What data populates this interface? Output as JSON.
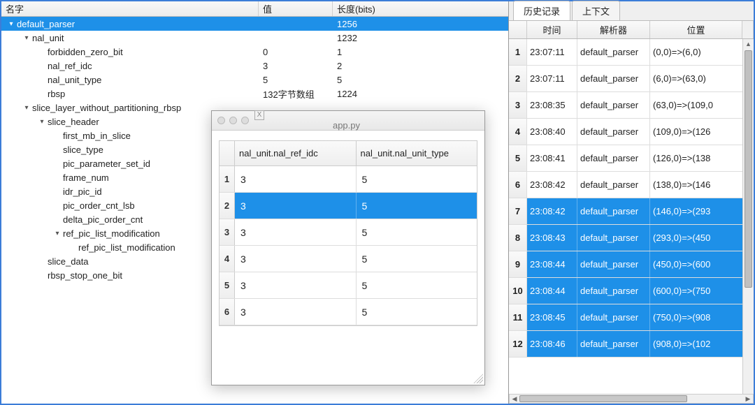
{
  "left": {
    "headers": {
      "name": "名字",
      "value": "值",
      "length": "长度(bits)"
    },
    "rows": [
      {
        "indent": 0,
        "toggle": "▾",
        "name": "default_parser",
        "value": "",
        "length": "1256",
        "selected": true
      },
      {
        "indent": 1,
        "toggle": "▾",
        "name": "nal_unit",
        "value": "",
        "length": "1232"
      },
      {
        "indent": 2,
        "toggle": "",
        "name": "forbidden_zero_bit",
        "value": "0",
        "length": "1"
      },
      {
        "indent": 2,
        "toggle": "",
        "name": "nal_ref_idc",
        "value": "3",
        "length": "2"
      },
      {
        "indent": 2,
        "toggle": "",
        "name": "nal_unit_type",
        "value": "5",
        "length": "5"
      },
      {
        "indent": 2,
        "toggle": "",
        "name": "rbsp",
        "value": "132字节数组",
        "length": "1224"
      },
      {
        "indent": 1,
        "toggle": "▾",
        "name": "slice_layer_without_partitioning_rbsp",
        "value": "",
        "length": ""
      },
      {
        "indent": 2,
        "toggle": "▾",
        "name": "slice_header",
        "value": "",
        "length": ""
      },
      {
        "indent": 3,
        "toggle": "",
        "name": "first_mb_in_slice",
        "value": "",
        "length": ""
      },
      {
        "indent": 3,
        "toggle": "",
        "name": "slice_type",
        "value": "",
        "length": ""
      },
      {
        "indent": 3,
        "toggle": "",
        "name": "pic_parameter_set_id",
        "value": "",
        "length": ""
      },
      {
        "indent": 3,
        "toggle": "",
        "name": "frame_num",
        "value": "",
        "length": ""
      },
      {
        "indent": 3,
        "toggle": "",
        "name": "idr_pic_id",
        "value": "",
        "length": ""
      },
      {
        "indent": 3,
        "toggle": "",
        "name": "pic_order_cnt_lsb",
        "value": "",
        "length": ""
      },
      {
        "indent": 3,
        "toggle": "",
        "name": "delta_pic_order_cnt",
        "value": "",
        "length": ""
      },
      {
        "indent": 3,
        "toggle": "▾",
        "name": "ref_pic_list_modification",
        "value": "",
        "length": ""
      },
      {
        "indent": 4,
        "toggle": "",
        "name": "ref_pic_list_modification",
        "value": "",
        "length": ""
      },
      {
        "indent": 2,
        "toggle": "",
        "name": "slice_data",
        "value": "",
        "length": ""
      },
      {
        "indent": 2,
        "toggle": "",
        "name": "rbsp_stop_one_bit",
        "value": "",
        "length": ""
      }
    ]
  },
  "tabs": {
    "history": "历史记录",
    "context": "上下文"
  },
  "history": {
    "headers": {
      "time": "时间",
      "parser": "解析器",
      "position": "位置"
    },
    "rows": [
      {
        "idx": "1",
        "time": "23:07:11",
        "parser": "default_parser",
        "pos": "(0,0)=>(6,0)",
        "selected": false
      },
      {
        "idx": "2",
        "time": "23:07:11",
        "parser": "default_parser",
        "pos": "(6,0)=>(63,0)",
        "selected": false
      },
      {
        "idx": "3",
        "time": "23:08:35",
        "parser": "default_parser",
        "pos": "(63,0)=>(109,0",
        "selected": false
      },
      {
        "idx": "4",
        "time": "23:08:40",
        "parser": "default_parser",
        "pos": "(109,0)=>(126",
        "selected": false
      },
      {
        "idx": "5",
        "time": "23:08:41",
        "parser": "default_parser",
        "pos": "(126,0)=>(138",
        "selected": false
      },
      {
        "idx": "6",
        "time": "23:08:42",
        "parser": "default_parser",
        "pos": "(138,0)=>(146",
        "selected": false
      },
      {
        "idx": "7",
        "time": "23:08:42",
        "parser": "default_parser",
        "pos": "(146,0)=>(293",
        "selected": true
      },
      {
        "idx": "8",
        "time": "23:08:43",
        "parser": "default_parser",
        "pos": "(293,0)=>(450",
        "selected": true
      },
      {
        "idx": "9",
        "time": "23:08:44",
        "parser": "default_parser",
        "pos": "(450,0)=>(600",
        "selected": true
      },
      {
        "idx": "10",
        "time": "23:08:44",
        "parser": "default_parser",
        "pos": "(600,0)=>(750",
        "selected": true
      },
      {
        "idx": "11",
        "time": "23:08:45",
        "parser": "default_parser",
        "pos": "(750,0)=>(908",
        "selected": true
      },
      {
        "idx": "12",
        "time": "23:08:46",
        "parser": "default_parser",
        "pos": "(908,0)=>(102",
        "selected": true
      }
    ]
  },
  "popup": {
    "title": "app.py",
    "app_icon_text": "X",
    "columns": [
      "nal_unit.nal_ref_idc",
      "nal_unit.nal_unit_type"
    ],
    "rows": [
      {
        "idx": "1",
        "c1": "3",
        "c2": "5",
        "selected": false
      },
      {
        "idx": "2",
        "c1": "3",
        "c2": "5",
        "selected": true
      },
      {
        "idx": "3",
        "c1": "3",
        "c2": "5",
        "selected": false
      },
      {
        "idx": "4",
        "c1": "3",
        "c2": "5",
        "selected": false
      },
      {
        "idx": "5",
        "c1": "3",
        "c2": "5",
        "selected": false
      },
      {
        "idx": "6",
        "c1": "3",
        "c2": "5",
        "selected": false
      }
    ]
  }
}
